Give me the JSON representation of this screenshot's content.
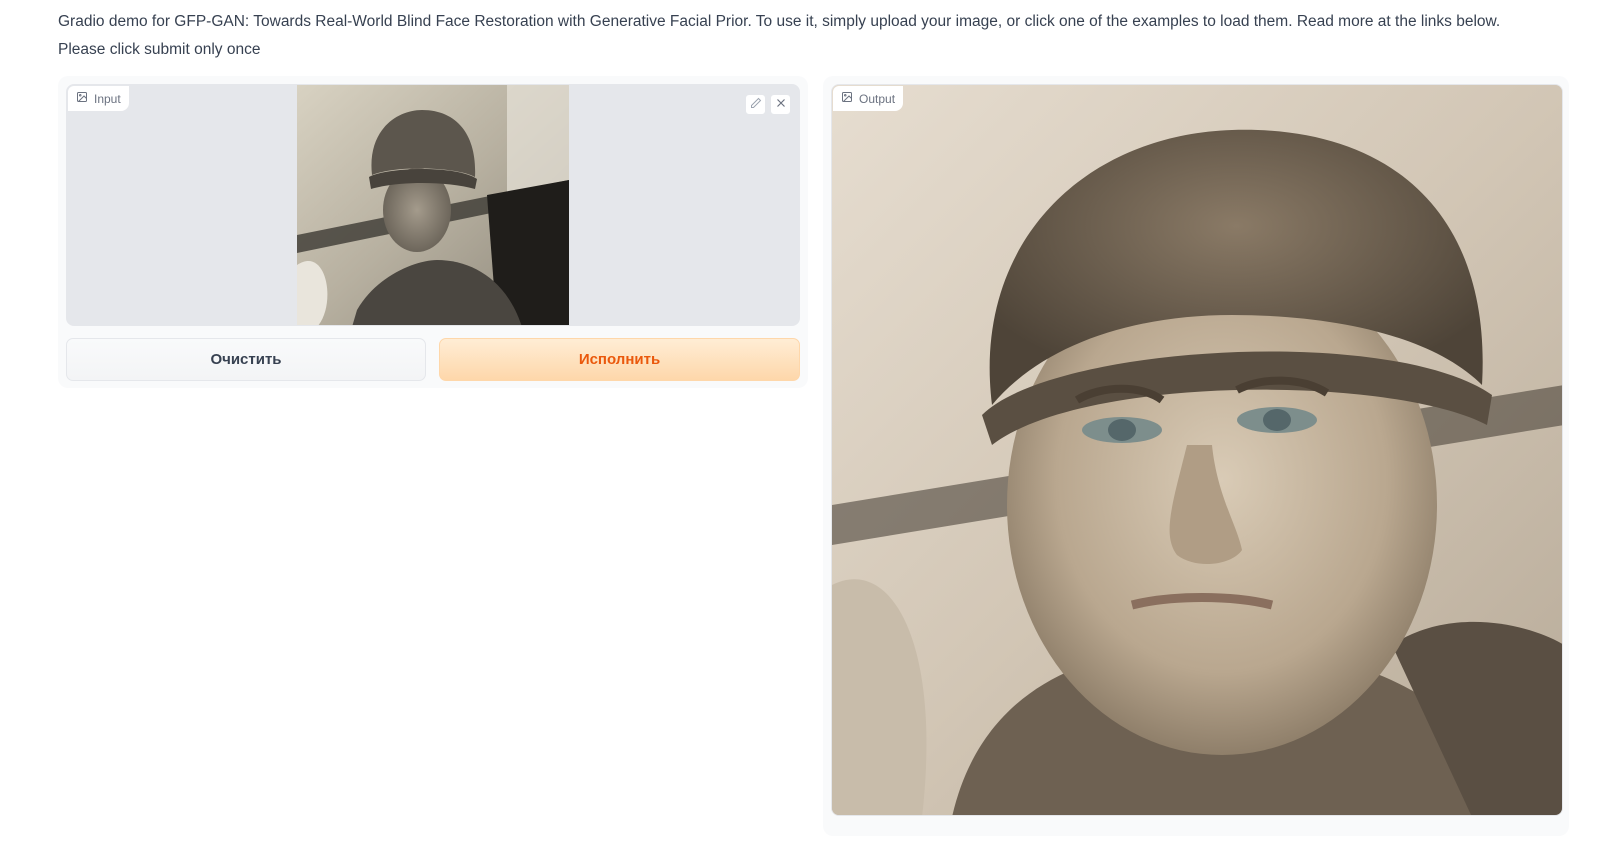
{
  "description": "Gradio demo for GFP-GAN: Towards Real-World Blind Face Restoration with Generative Facial Prior. To use it, simply upload your image, or click one of the examples to load them. Read more at the links below. Please click submit only once",
  "input": {
    "label": "Input",
    "label_icon": "image-icon",
    "tools": [
      "edit-icon",
      "close-icon"
    ]
  },
  "output": {
    "label": "Output",
    "label_icon": "image-icon"
  },
  "buttons": {
    "clear_label": "Очистить",
    "submit_label": "Исполнить"
  },
  "colors": {
    "submit_bg": "#fed7aa",
    "submit_text": "#ea580c",
    "panel_bg": "#f9fafb"
  }
}
